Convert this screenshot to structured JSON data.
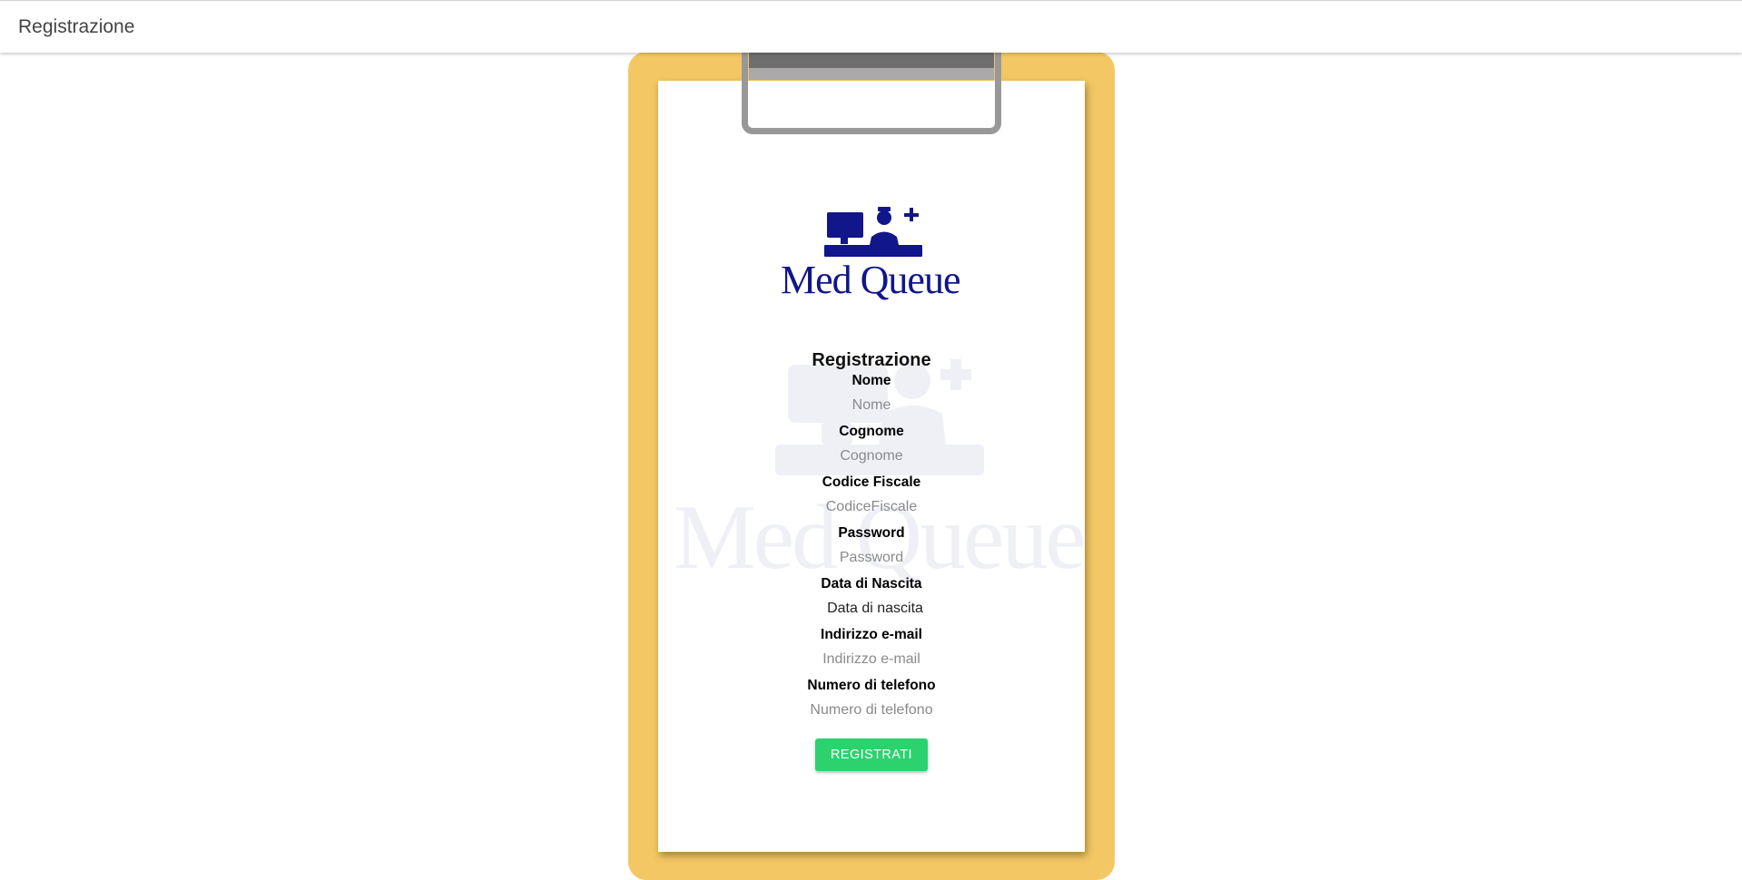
{
  "toolbar": {
    "title": "Registrazione"
  },
  "logo": {
    "brand": "Med Queue"
  },
  "form": {
    "title": "Registrazione",
    "fields": [
      {
        "label": "Nome",
        "placeholder": "Nome"
      },
      {
        "label": "Cognome",
        "placeholder": "Cognome"
      },
      {
        "label": "Codice Fiscale",
        "placeholder": "CodiceFiscale"
      },
      {
        "label": "Password",
        "placeholder": "Password"
      },
      {
        "label": "Data di Nascita",
        "value": "Data di nascita"
      },
      {
        "label": "Indirizzo e-mail",
        "placeholder": "Indirizzo e-mail"
      },
      {
        "label": "Numero di telefono",
        "placeholder": "Numero di telefono"
      }
    ],
    "submit_label": "REGISTRATI"
  },
  "colors": {
    "board": "#f3c763",
    "brand": "#11168a",
    "submit": "#2bd26e",
    "clip": "#989898"
  },
  "icons": [
    "reception-desk-icon",
    "nurse-icon",
    "medical-cross-icon",
    "monitor-icon"
  ]
}
